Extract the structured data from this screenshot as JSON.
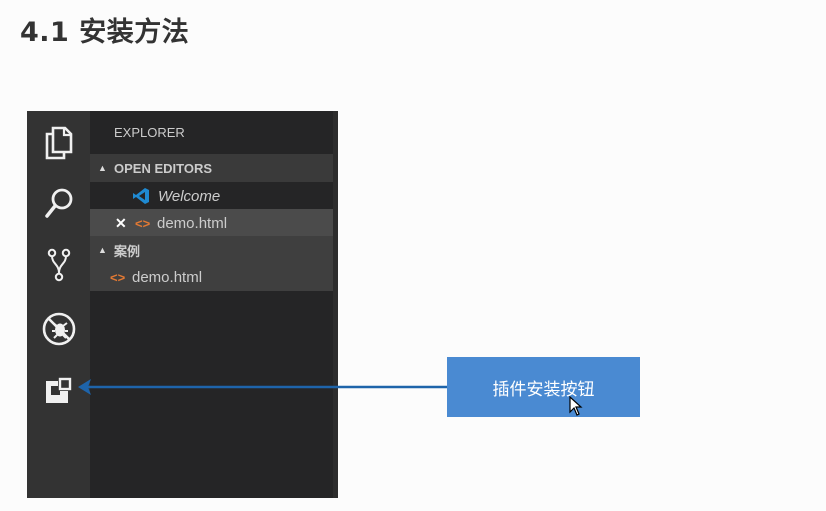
{
  "page": {
    "heading": "4.1 安装方法"
  },
  "editor": {
    "sidebar_title": "EXPLORER",
    "open_editors": {
      "header": "OPEN EDITORS",
      "items": [
        {
          "label": "Welcome",
          "icon": "vscode-logo-icon"
        },
        {
          "label": "demo.html",
          "icon": "html-file-icon",
          "close": "✕"
        }
      ]
    },
    "folder": {
      "header": "案例",
      "items": [
        {
          "label": "demo.html",
          "icon": "html-file-icon"
        }
      ]
    },
    "activity_bar": [
      "files-icon",
      "search-icon",
      "source-control-icon",
      "debug-icon",
      "extensions-icon"
    ]
  },
  "callout": {
    "label": "插件安装按钮"
  },
  "colors": {
    "accent": "#4a8ad2",
    "arrow": "#1e64aa",
    "activity_bar": "#333333",
    "sidebar": "#252526"
  }
}
